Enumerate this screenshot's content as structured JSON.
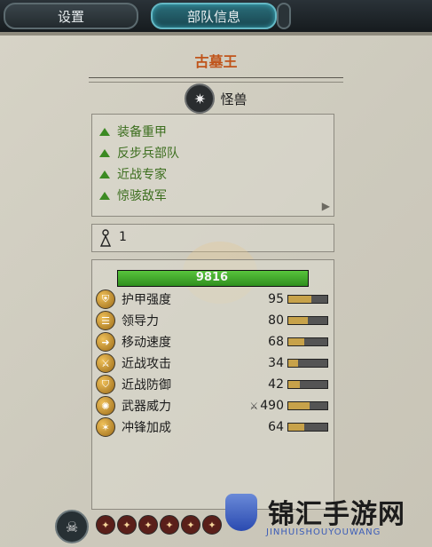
{
  "tabs": {
    "settings": "设置",
    "unit_info": "部队信息"
  },
  "unit": {
    "name": "古墓王",
    "class_label": "怪兽",
    "class_icon": "monster-class-icon"
  },
  "attributes": [
    {
      "label": "装备重甲"
    },
    {
      "label": "反步兵部队"
    },
    {
      "label": "近战专家"
    },
    {
      "label": "惊骇敌军"
    }
  ],
  "unit_size": {
    "icon": "unit-size-icon",
    "value": "1"
  },
  "health": {
    "value": "9816",
    "fraction": 1.0
  },
  "stats": [
    {
      "label": "护甲强度",
      "value": "95",
      "icon": "armour-icon",
      "fraction": 0.6
    },
    {
      "label": "领导力",
      "value": "80",
      "icon": "leadership-icon",
      "fraction": 0.5
    },
    {
      "label": "移动速度",
      "value": "68",
      "icon": "speed-icon",
      "fraction": 0.4
    },
    {
      "label": "近战攻击",
      "value": "34",
      "icon": "melee-attack-icon",
      "fraction": 0.25
    },
    {
      "label": "近战防御",
      "value": "42",
      "icon": "melee-defence-icon",
      "fraction": 0.3
    },
    {
      "label": "武器威力",
      "value": "490",
      "icon": "weapon-strength-icon",
      "fraction": 0.55
    },
    {
      "label": "冲锋加成",
      "value": "64",
      "icon": "charge-bonus-icon",
      "fraction": 0.4
    }
  ],
  "colors": {
    "title": "#c0541a",
    "attribute_text": "#3c6e1e",
    "health_bar": "#3fa52a"
  },
  "watermark": {
    "text": "锦汇手游网",
    "sub": "JINHUISHOUYOUWANG"
  }
}
